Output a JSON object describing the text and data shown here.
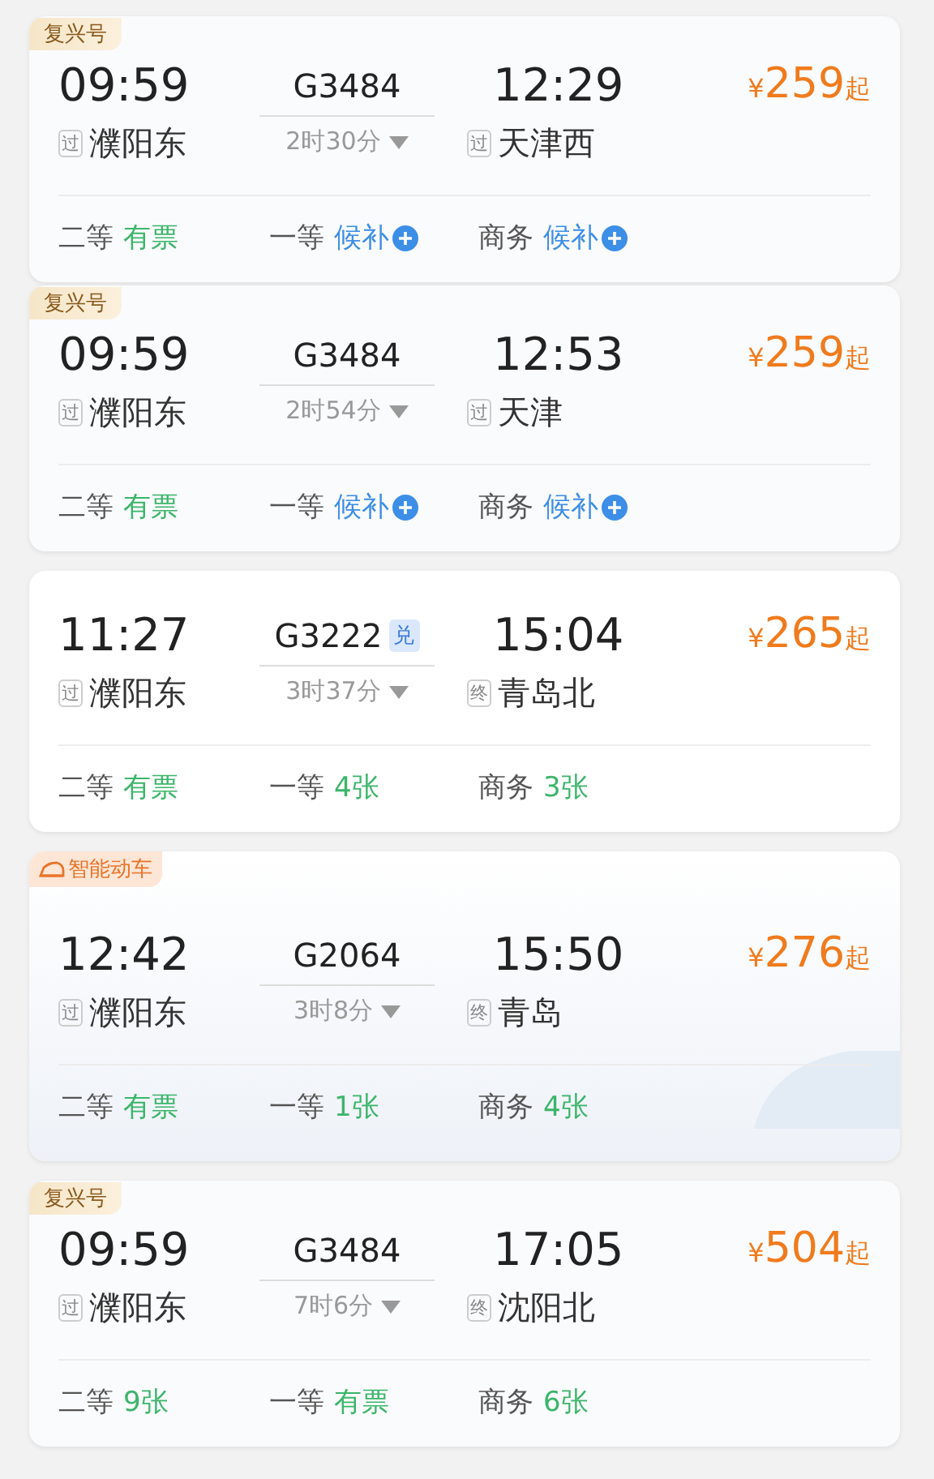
{
  "trains": [
    {
      "tag": {
        "kind": "fuxing",
        "text": "复兴号"
      },
      "depart_time": "09:59",
      "depart_mark": "过",
      "depart_station": "濮阳东",
      "train_no": "G3484",
      "duration": "2时30分",
      "arrive_time": "12:29",
      "arrive_mark": "过",
      "arrive_station": "天津西",
      "currency": "¥",
      "price": "259",
      "price_suffix": "起",
      "seats": [
        {
          "class": "二等",
          "status": "有票",
          "kind": "available"
        },
        {
          "class": "一等",
          "status": "候补",
          "kind": "waitlist"
        },
        {
          "class": "商务",
          "status": "候补",
          "kind": "waitlist"
        }
      ]
    },
    {
      "tag": {
        "kind": "fuxing",
        "text": "复兴号"
      },
      "depart_time": "09:59",
      "depart_mark": "过",
      "depart_station": "濮阳东",
      "train_no": "G3484",
      "duration": "2时54分",
      "arrive_time": "12:53",
      "arrive_mark": "过",
      "arrive_station": "天津",
      "currency": "¥",
      "price": "259",
      "price_suffix": "起",
      "seats": [
        {
          "class": "二等",
          "status": "有票",
          "kind": "available"
        },
        {
          "class": "一等",
          "status": "候补",
          "kind": "waitlist"
        },
        {
          "class": "商务",
          "status": "候补",
          "kind": "waitlist"
        }
      ]
    },
    {
      "depart_time": "11:27",
      "depart_mark": "过",
      "depart_station": "濮阳东",
      "train_no": "G3222",
      "badge": "兑",
      "duration": "3时37分",
      "arrive_time": "15:04",
      "arrive_mark": "终",
      "arrive_station": "青岛北",
      "currency": "¥",
      "price": "265",
      "price_suffix": "起",
      "seats": [
        {
          "class": "二等",
          "status": "有票",
          "kind": "available"
        },
        {
          "class": "一等",
          "status": "4张",
          "kind": "available"
        },
        {
          "class": "商务",
          "status": "3张",
          "kind": "available"
        }
      ]
    },
    {
      "tag": {
        "kind": "smart",
        "text": "智能动车"
      },
      "depart_time": "12:42",
      "depart_mark": "过",
      "depart_station": "濮阳东",
      "train_no": "G2064",
      "duration": "3时8分",
      "arrive_time": "15:50",
      "arrive_mark": "终",
      "arrive_station": "青岛",
      "currency": "¥",
      "price": "276",
      "price_suffix": "起",
      "seats": [
        {
          "class": "二等",
          "status": "有票",
          "kind": "available"
        },
        {
          "class": "一等",
          "status": "1张",
          "kind": "available"
        },
        {
          "class": "商务",
          "status": "4张",
          "kind": "available"
        }
      ]
    },
    {
      "tag": {
        "kind": "fuxing",
        "text": "复兴号"
      },
      "depart_time": "09:59",
      "depart_mark": "过",
      "depart_station": "濮阳东",
      "train_no": "G3484",
      "duration": "7时6分",
      "arrive_time": "17:05",
      "arrive_mark": "终",
      "arrive_station": "沈阳北",
      "currency": "¥",
      "price": "504",
      "price_suffix": "起",
      "seats": [
        {
          "class": "二等",
          "status": "9张",
          "kind": "available"
        },
        {
          "class": "一等",
          "status": "有票",
          "kind": "available"
        },
        {
          "class": "商务",
          "status": "6张",
          "kind": "available"
        }
      ]
    }
  ]
}
